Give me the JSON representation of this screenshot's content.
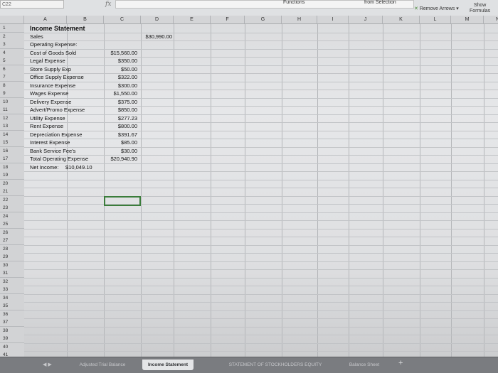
{
  "ribbon": {
    "name_box": "C22",
    "fx_symbol": "fx",
    "functions_label": "Functions",
    "selection_label": "from Selection",
    "remove_arrows_label": "Remove Arrows",
    "show_formulas_label_1": "Show",
    "show_formulas_label_2": "Formulas"
  },
  "columns": [
    "A",
    "B",
    "C",
    "D",
    "E",
    "F",
    "G",
    "H",
    "I",
    "J",
    "K",
    "L",
    "M",
    "N"
  ],
  "rows": [
    "1",
    "2",
    "3",
    "4",
    "5",
    "6",
    "7",
    "8",
    "9",
    "10",
    "11",
    "12",
    "13",
    "14",
    "15",
    "16",
    "17",
    "18",
    "19",
    "20",
    "21",
    "22",
    "23",
    "24",
    "25",
    "26",
    "27",
    "28",
    "29",
    "30",
    "31",
    "32",
    "33",
    "34",
    "35",
    "36",
    "37",
    "38",
    "39",
    "40",
    "41"
  ],
  "sheet": {
    "title": "Income Statement",
    "sales_label": "Sales",
    "sales_value": "$30,990.00",
    "operating_label": "Operating Expense:",
    "expenses": [
      {
        "label": "Cost of Goods Sold",
        "value": "$15,560.00"
      },
      {
        "label": "Legal Expense",
        "value": "$350.00"
      },
      {
        "label": "Store Supply Exp",
        "value": "$50.00"
      },
      {
        "label": "Office Supply Expense",
        "value": "$322.00"
      },
      {
        "label": "Insurance Expense",
        "value": "$300.00"
      },
      {
        "label": "Wages Expense",
        "value": "$1,550.00"
      },
      {
        "label": "Delivery Expense",
        "value": "$375.00"
      },
      {
        "label": "Advert/Promo Expense",
        "value": "$850.00"
      },
      {
        "label": "Utility Expense",
        "value": "$277.23"
      },
      {
        "label": "Rent Expense",
        "value": "$800.00"
      },
      {
        "label": "Depreciation Expense",
        "value": "$391.67"
      },
      {
        "label": "Interest Expense",
        "value": "$85.00"
      },
      {
        "label": "Bank Service Fee's",
        "value": "$30.00"
      }
    ],
    "total_label": "Total Operating Expense",
    "total_value": "$20,940.90",
    "net_income_label": "Net Income:",
    "net_income_value": "$10,049.10"
  },
  "tabs": [
    {
      "label": "Adjusted Trial Balance",
      "active": false
    },
    {
      "label": "Income Statement",
      "active": true
    },
    {
      "label": "STATEMENT OF STOCKHOLDERS EQUITY",
      "active": false
    },
    {
      "label": "Balance Sheet",
      "active": false
    }
  ],
  "tab_add_symbol": "+",
  "tab_nav_symbol": "◀ ▶"
}
